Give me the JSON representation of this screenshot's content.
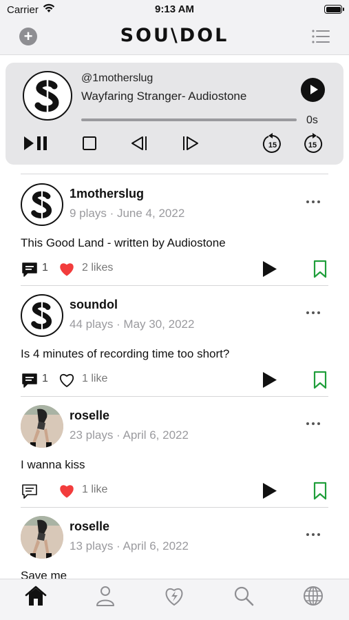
{
  "status_bar": {
    "carrier": "Carrier",
    "time": "9:13 AM",
    "battery_level": 1.0
  },
  "header": {
    "logo": "SOU\\DOL",
    "add_icon": "plus-circle-icon",
    "menu_icon": "list-icon"
  },
  "player": {
    "username": "@1motherslug",
    "track_title": "Wayfaring Stranger- Audiostone",
    "elapsed": "0s",
    "progress": 0,
    "controls": [
      "play-pause-icon",
      "stop-icon",
      "previous-icon",
      "next-icon",
      "rewind-15-icon",
      "forward-15-icon"
    ],
    "skip_seconds": "15"
  },
  "posts": [
    {
      "name": "1motherslug",
      "meta": "9 plays · June 4, 2022",
      "text": "This Good Land - written by Audiostone",
      "comments": "1",
      "comment_filled": true,
      "likes": "2 likes",
      "liked": true,
      "avatar": "s-logo"
    },
    {
      "name": "soundol",
      "meta": "44 plays · May 30, 2022",
      "text": "Is 4 minutes of recording time too short?",
      "comments": "1",
      "comment_filled": true,
      "likes": "1 like",
      "liked": false,
      "avatar": "s-logo"
    },
    {
      "name": "roselle",
      "meta": "23 plays · April 6, 2022",
      "text": "I wanna kiss",
      "comments": "",
      "comment_filled": false,
      "likes": "1 like",
      "liked": true,
      "avatar": "photo"
    },
    {
      "name": "roselle",
      "meta": "13 plays · April 6, 2022",
      "text": "Save me",
      "comments": "",
      "comment_filled": false,
      "likes": "",
      "liked": false,
      "avatar": "photo"
    }
  ],
  "tabs": [
    {
      "icon": "home-icon",
      "active": true
    },
    {
      "icon": "profile-icon",
      "active": false
    },
    {
      "icon": "heart-bolt-icon",
      "active": false
    },
    {
      "icon": "search-icon",
      "active": false
    },
    {
      "icon": "globe-icon",
      "active": false
    }
  ],
  "colors": {
    "like_red": "#f23c3c",
    "bookmark_green": "#1f9e3a",
    "card_bg": "#e6e6e8",
    "muted": "#9a9a9e"
  }
}
